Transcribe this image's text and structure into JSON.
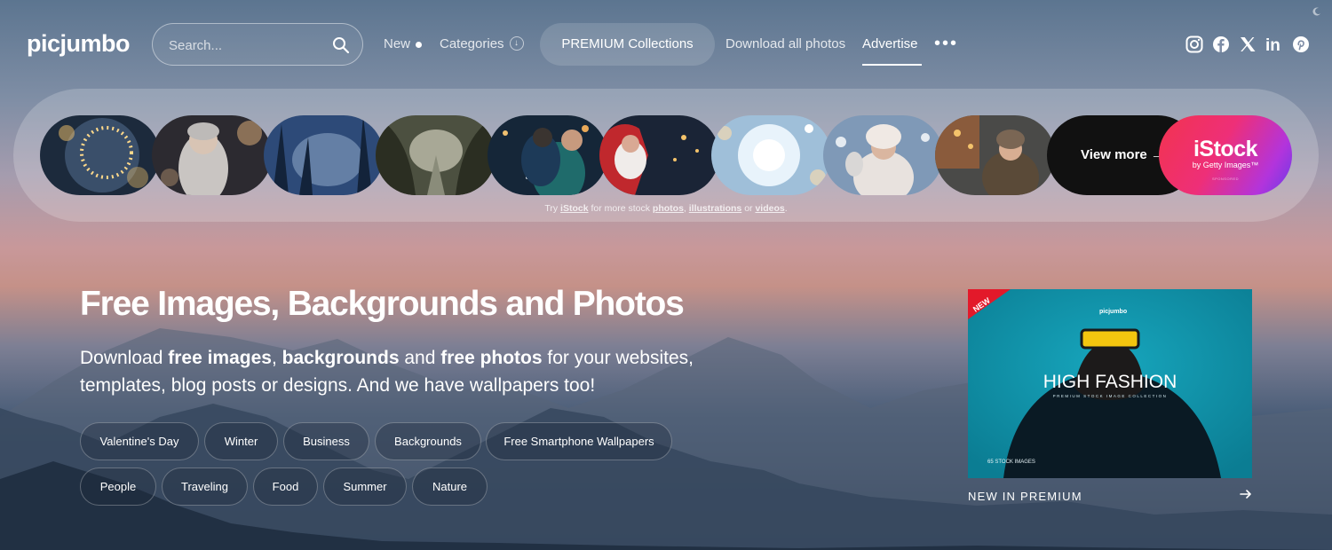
{
  "header": {
    "logo": "picjumbo",
    "search_placeholder": "Search...",
    "nav": {
      "new_label": "New",
      "categories_label": "Categories",
      "premium_label": "PREMIUM Collections",
      "download_label": "Download all photos",
      "advertise_label": "Advertise",
      "more_label": "•••"
    },
    "social": [
      "instagram-icon",
      "facebook-icon",
      "x-icon",
      "linkedin-icon",
      "pinterest-icon"
    ],
    "social_labels": {
      "linkedin": "in"
    }
  },
  "strip": {
    "thumbnails": [
      "fairy-lights",
      "woman-with-sparklers",
      "misty-forest-path",
      "tree-tunnel-road",
      "couple-hugging-snow",
      "santa-blowing-snow",
      "sparkling-snow-bokeh",
      "woman-in-snow",
      "woman-winter-market"
    ],
    "view_more": "View more →",
    "istock_brand": "iStock",
    "istock_by": "by Getty Images™",
    "istock_sponsored": "SPONSORED",
    "note": {
      "prefix": "Try ",
      "istock": "iStock",
      "mid": " for more stock ",
      "photos": "photos",
      "comma": ", ",
      "illustrations": "illustrations",
      "or": " or ",
      "videos": "videos",
      "end": "."
    }
  },
  "hero": {
    "title": "Free Images, Backgrounds and Photos",
    "sub_1": "Download ",
    "sub_b1": "free images",
    "sub_2": ", ",
    "sub_b2": "backgrounds",
    "sub_3": " and ",
    "sub_b3": "free photos",
    "sub_4": " for your websites, templates, blog posts or designs. And we have wallpapers too!",
    "tags": [
      "Valentine's Day",
      "Winter",
      "Business",
      "Backgrounds",
      "Free Smartphone Wallpapers",
      "People",
      "Traveling",
      "Food",
      "Summer",
      "Nature"
    ]
  },
  "promo": {
    "badge": "NEW",
    "brand": "picjumbo",
    "title": "HIGH FASHION",
    "subtitle": "PREMIUM STOCK IMAGE COLLECTION",
    "count": "65 STOCK IMAGES",
    "caption": "NEW IN PREMIUM"
  },
  "colors": {
    "premium_bg": "#0b8fa6",
    "istock_gradient": [
      "#f2334f",
      "#b234dc",
      "#6a3be6"
    ],
    "view_more_bg": "#111111"
  }
}
